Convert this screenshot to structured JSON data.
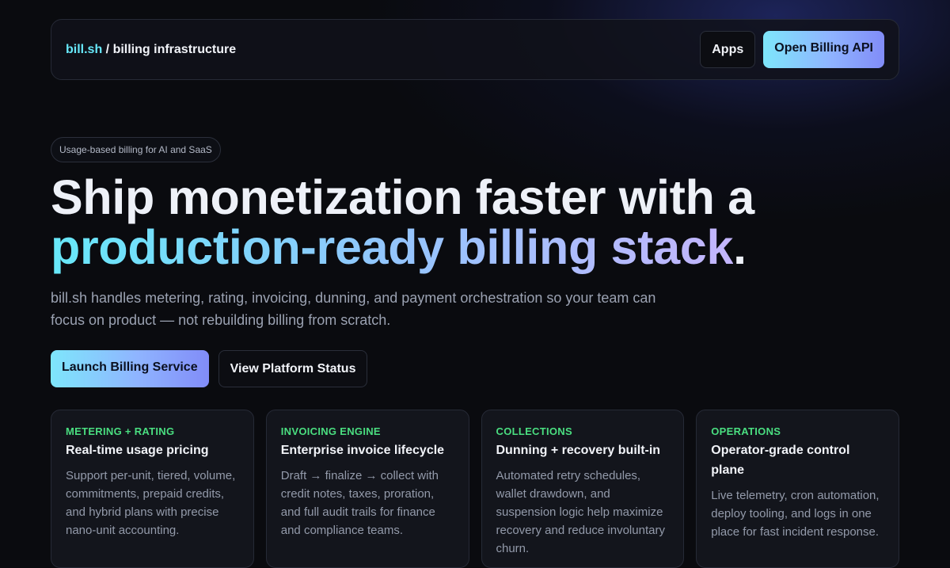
{
  "nav": {
    "brand_accent": "bill.sh",
    "brand_rest": " / billing infrastructure",
    "apps_label": "Apps",
    "api_label": "Open Billing API"
  },
  "hero": {
    "pill": "Usage-based billing for AI and SaaS",
    "headline_line1": "Ship monetization faster with a",
    "headline_accent": "production-ready billing stack",
    "headline_end": ".",
    "subtitle": "bill.sh handles metering, rating, invoicing, dunning, and payment orchestration so your team can focus on product — not rebuilding billing from scratch.",
    "primary_cta": "Launch Billing Service",
    "secondary_cta": "View Platform Status"
  },
  "cards": [
    {
      "kicker": "METERING + RATING",
      "title": "Real-time usage pricing",
      "desc": "Support per-unit, tiered, volume, commitments, prepaid credits, and hybrid plans with precise nano-unit accounting."
    },
    {
      "kicker": "INVOICING ENGINE",
      "title": "Enterprise invoice lifecycle",
      "desc": "Draft → finalize → collect with credit notes, taxes, proration, and full audit trails for finance and compliance teams."
    },
    {
      "kicker": "COLLECTIONS",
      "title": "Dunning + recovery built-in",
      "desc": "Automated retry schedules, wallet drawdown, and suspension logic help maximize recovery and reduce involuntary churn."
    },
    {
      "kicker": "OPERATIONS",
      "title": "Operator-grade control plane",
      "desc": "Live telemetry, cron automation, deploy tooling, and logs in one place for fast incident response."
    }
  ],
  "colors": {
    "accent_cyan": "#67e8f9",
    "accent_indigo": "#818cf8",
    "kicker_green": "#4ade80",
    "background": "#0a0b0f"
  }
}
